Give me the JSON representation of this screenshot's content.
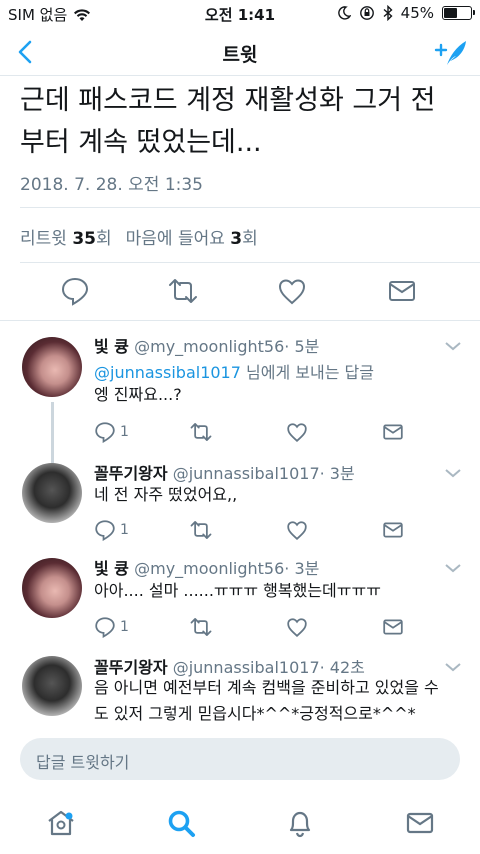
{
  "status_bar": {
    "carrier": "SIM 없음",
    "time": "오전 1:41",
    "battery_text": "45%",
    "battery_level": 0.45
  },
  "nav": {
    "title": "트윗",
    "back_icon": "chevron-left-icon",
    "compose_icon": "compose-tweet-icon"
  },
  "tweet": {
    "text": "근데 패스코드 계정 재활성화 그거 전부터 계속 떴었는데...",
    "timestamp": "2018. 7. 28. 오전 1:35",
    "retweets_label": "리트윗",
    "retweets_count": "35",
    "retweets_unit": "회",
    "likes_label": "마음에 들어요",
    "likes_count": "3",
    "likes_unit": "회"
  },
  "replies": [
    {
      "name": "빛 큥",
      "handle": "@my_moonlight56",
      "time": "· 5분",
      "reply_to_mention": "@junnassibal1017",
      "reply_to_suffix": " 님에게 보내는 답글",
      "text": "엥 진짜요...?",
      "reply_count": "1"
    },
    {
      "name": "꼴뚜기왕자",
      "handle": "@junnassibal1017",
      "time": "· 3분",
      "text": "네 전 자주 떴었어요,,",
      "reply_count": "1"
    },
    {
      "name": "빛 큥",
      "handle": "@my_moonlight56",
      "time": "· 3분",
      "text": "아아.... 설마 ......ㅠㅠㅠ 행복했는데ㅠㅠㅠ",
      "reply_count": "1"
    },
    {
      "name": "꼴뚜기왕자",
      "handle": "@junnassibal1017",
      "time": "· 42초",
      "text_line1": "음 아니면 예전부터 계속 컴백을 준비하고 있었을 수",
      "text_line2": "도 있저 그렇게 믿읍시다*^^*긍정적으로*^^*"
    }
  ],
  "reply_input": {
    "placeholder": "답글 트윗하기"
  },
  "colors": {
    "accent": "#1da1f2",
    "text": "#14171a",
    "muted": "#657786",
    "divider": "#e1e8ed"
  }
}
